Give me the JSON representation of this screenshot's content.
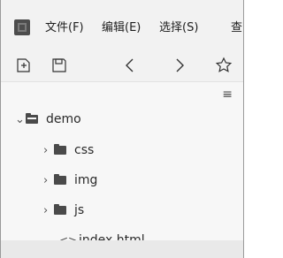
{
  "menubar": {
    "items": [
      {
        "label": "文件(F)"
      },
      {
        "label": "编辑(E)"
      },
      {
        "label": "选择(S)"
      },
      {
        "label": "查"
      }
    ]
  },
  "toolbar": {
    "icons": [
      "new-file-icon",
      "save-icon",
      "back-icon",
      "forward-icon",
      "bookmark-star-icon"
    ]
  },
  "explorer": {
    "menu_icon": "≡",
    "tree": [
      {
        "label": "demo",
        "type": "folder",
        "expanded": true
      },
      {
        "label": "css",
        "type": "folder",
        "expanded": false
      },
      {
        "label": "img",
        "type": "folder",
        "expanded": false
      },
      {
        "label": "js",
        "type": "folder",
        "expanded": false
      },
      {
        "label": "index.html",
        "type": "file"
      }
    ]
  }
}
